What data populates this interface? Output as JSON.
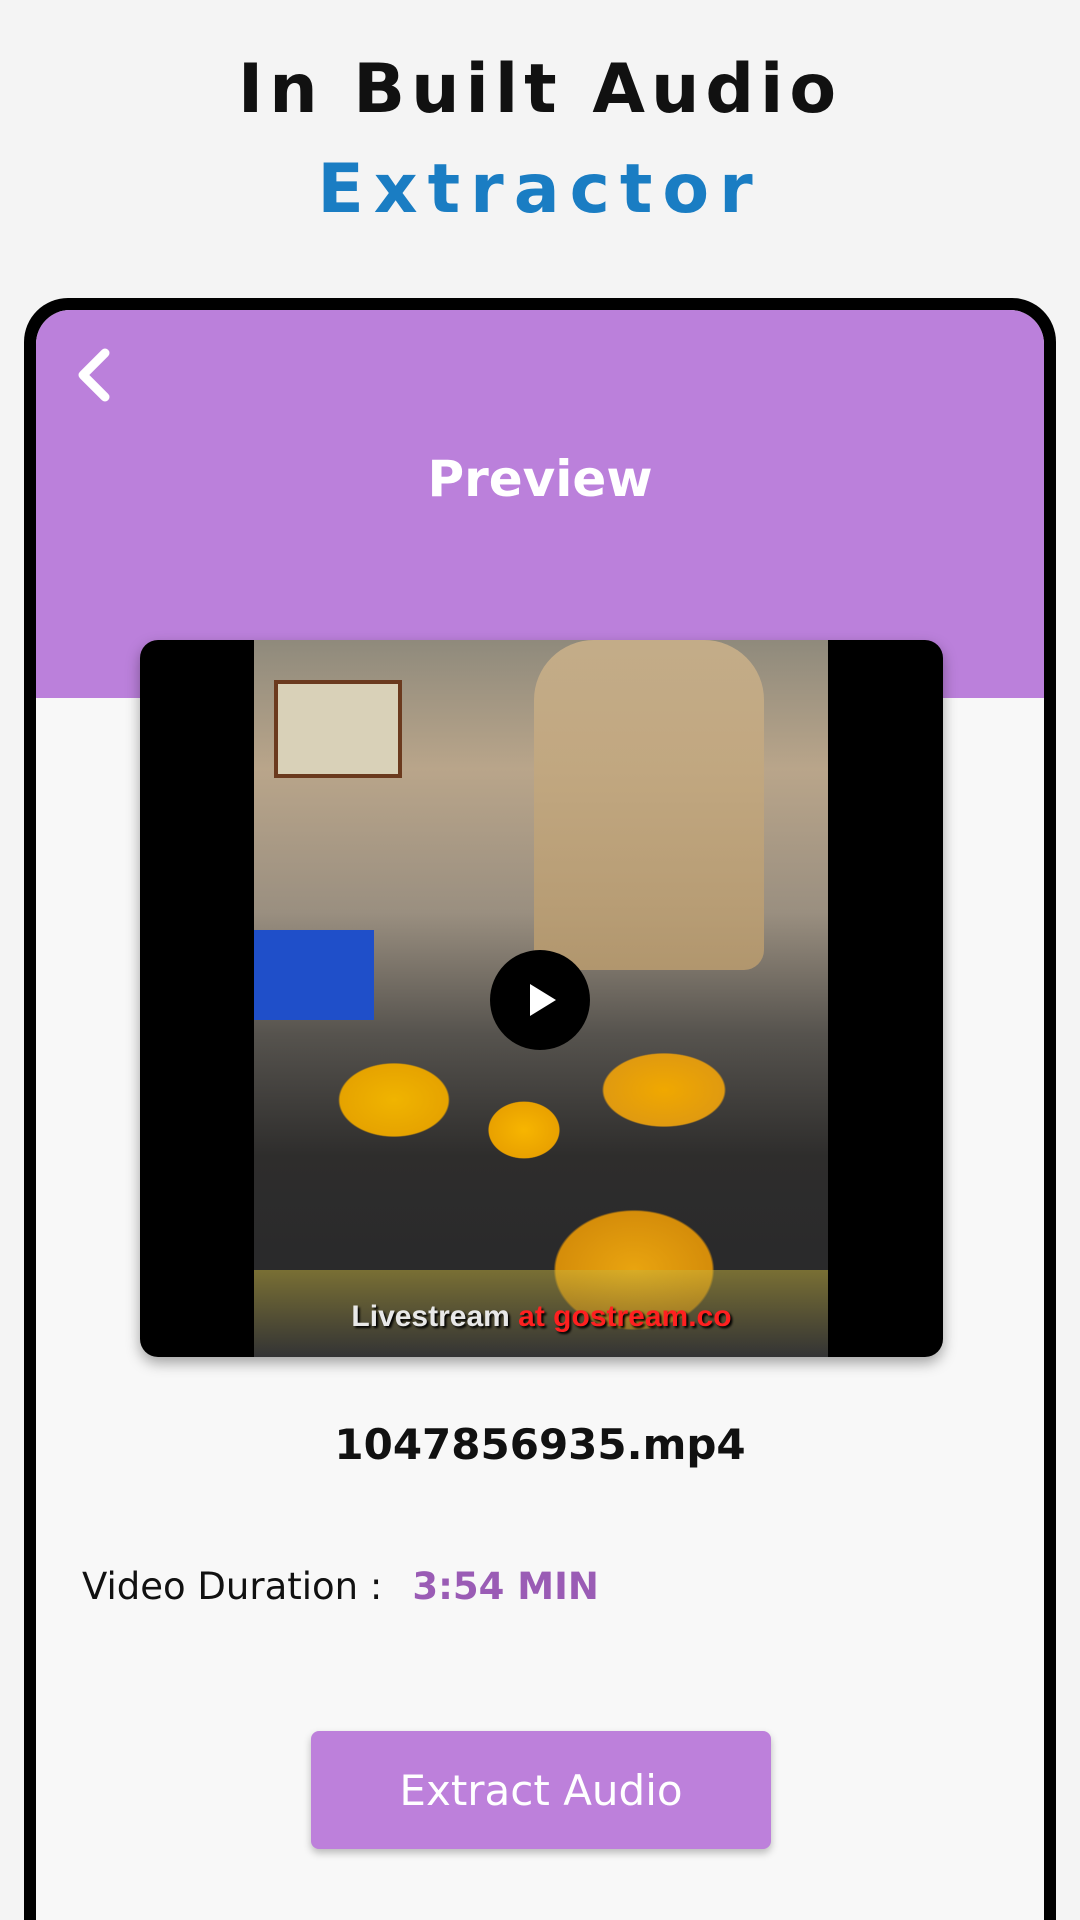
{
  "headline": {
    "line1": "In Built Audio",
    "line2": "Extractor"
  },
  "appbar": {
    "back_icon": "chevron-left-icon",
    "title": "Preview"
  },
  "video": {
    "play_icon": "play-icon",
    "watermark_prefix": "Livestream ",
    "watermark_highlight": "at gostream.co"
  },
  "file": {
    "name": "1047856935.mp4",
    "duration_label": "Video Duration :",
    "duration_value": "3:54 MIN"
  },
  "actions": {
    "extract_label": "Extract Audio"
  },
  "colors": {
    "accent": "#bb80db",
    "headline_blue": "#1a7dc3",
    "duration_purple": "#9a5cb5"
  }
}
